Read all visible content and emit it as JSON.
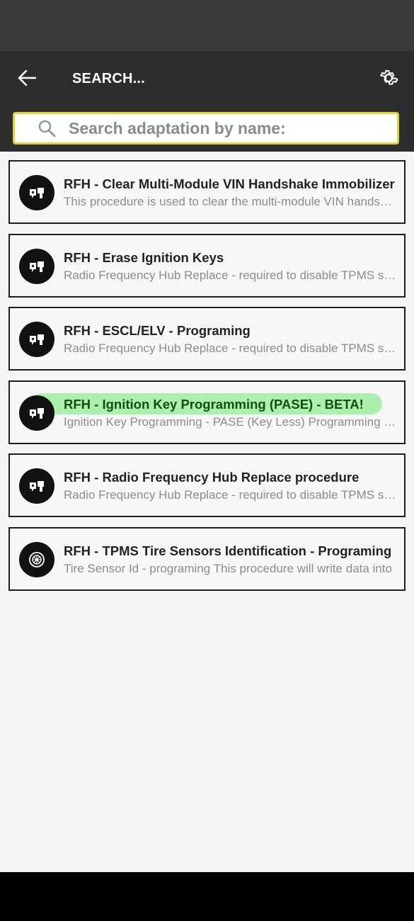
{
  "header": {
    "title": "SEARCH...",
    "back_icon": "arrow-left-icon",
    "settings_icon": "gear-icon"
  },
  "search": {
    "placeholder": "Search adaptation by name:",
    "value": "",
    "icon": "search-icon",
    "border_color": "#e4d23b"
  },
  "items": [
    {
      "icon": "key-fob-icon",
      "title": "RFH - Clear Multi-Module VIN Handshake Immobilizer",
      "subtitle": "This procedure is used to clear the multi-module VIN handshake"
    },
    {
      "icon": "key-fob-icon",
      "title": "RFH - Erase Ignition Keys",
      "subtitle": "Radio Frequency Hub Replace - required to disable TPMS sensors"
    },
    {
      "icon": "key-fob-icon",
      "title": "RFH - ESCL/ELV - Programing",
      "subtitle": "Radio Frequency Hub Replace - required to disable TPMS sensors"
    },
    {
      "icon": "key-fob-icon",
      "title": "RFH - Ignition Key Programming (PASE) - BETA!",
      "subtitle": "Ignition Key Programming - PASE (Key Less) Programming procedure",
      "highlighted": true
    },
    {
      "icon": "key-fob-icon",
      "title": "RFH - Radio Frequency Hub Replace procedure",
      "subtitle": "Radio Frequency Hub Replace - required to disable TPMS sensors"
    },
    {
      "icon": "tire-icon",
      "title": "RFH - TPMS Tire Sensors Identification - Programing",
      "subtitle": "Tire Sensor Id - programing This procedure will write data into"
    }
  ],
  "colors": {
    "status_bar": "#3a3a3a",
    "app_bar": "#2d2d2d",
    "highlight": "#6eeb6e"
  }
}
